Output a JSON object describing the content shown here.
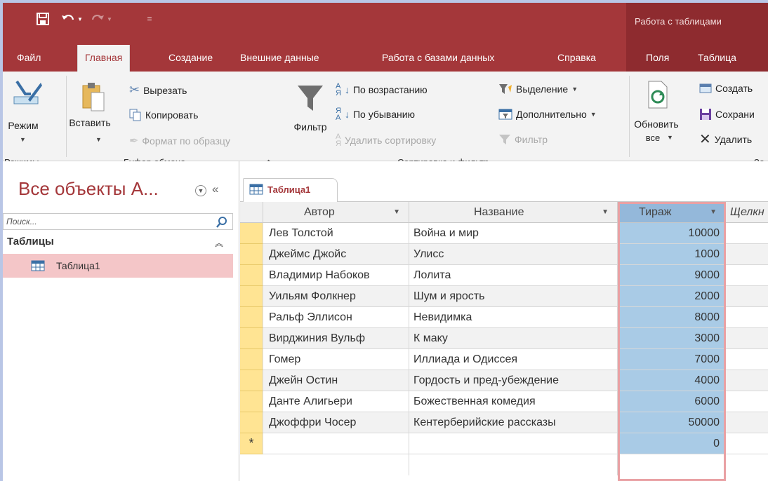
{
  "quick_access": {
    "save_icon": "save-icon",
    "undo_icon": "undo-icon",
    "redo_icon": "redo-icon",
    "customize_glyph": "="
  },
  "context_title": "Работа с таблицами",
  "tabs": [
    {
      "label": "Файл"
    },
    {
      "label": "Главная",
      "active": true
    },
    {
      "label": "Создание"
    },
    {
      "label": "Внешние данные"
    },
    {
      "label": "Работа с базами данных"
    },
    {
      "label": "Справка"
    },
    {
      "label": "Поля"
    },
    {
      "label": "Таблица"
    }
  ],
  "ribbon": {
    "views": {
      "button": "Режим",
      "group": "Режимы"
    },
    "clipboard": {
      "paste": "Вставить",
      "cut": "Вырезать",
      "copy": "Копировать",
      "format_painter": "Формат по образцу",
      "group": "Буфер обмена"
    },
    "sort_filter": {
      "filter": "Фильтр",
      "ascending": "По возрастанию",
      "descending": "По убыванию",
      "remove_sort": "Удалить сортировку",
      "selection": "Выделение",
      "advanced": "Дополнительно",
      "toggle_filter": "Фильтр",
      "group": "Сортировка и фильтр"
    },
    "records": {
      "refresh_line1": "Обновить",
      "refresh_line2": "все",
      "new": "Создать",
      "save": "Сохрани",
      "delete": "Удалить",
      "group": "За"
    }
  },
  "nav_pane": {
    "title": "Все объекты А...",
    "search_placeholder": "Поиск...",
    "group_label": "Таблицы",
    "items": [
      {
        "label": "Таблица1"
      }
    ]
  },
  "document": {
    "tab_label": "Таблица1",
    "columns": [
      "Автор",
      "Название",
      "Тираж",
      "Щелкн"
    ],
    "rows": [
      {
        "author": "Лев Толстой",
        "title": "Война и мир",
        "tirazh": "10000"
      },
      {
        "author": "Джеймс Джойс",
        "title": "Улисс",
        "tirazh": "1000"
      },
      {
        "author": "Владимир Набоков",
        "title": "Лолита",
        "tirazh": "9000"
      },
      {
        "author": "Уильям Фолкнер",
        "title": "Шум и ярость",
        "tirazh": "2000"
      },
      {
        "author": "Ральф Эллисон",
        "title": "Невидимка",
        "tirazh": "8000"
      },
      {
        "author": "Вирджиния Вульф",
        "title": " К маку",
        "tirazh": "3000"
      },
      {
        "author": "Гомер",
        "title": "Иллиада и Одиссея",
        "tirazh": "7000"
      },
      {
        "author": "Джейн Остин",
        "title": "Гордость и пред-убеждение",
        "tirazh": "4000"
      },
      {
        "author": "Данте Алигьери",
        "title": "Божественная комедия",
        "tirazh": "6000"
      },
      {
        "author": "Джоффри Чосер",
        "title": "Кентерберийские рассказы",
        "tirazh": "50000"
      }
    ],
    "new_row_marker": "*",
    "new_row_tirazh": "0"
  },
  "colors": {
    "brand": "#a4373a",
    "brand_dark": "#8e2b2f",
    "selected_column": "#a9cbe6",
    "record_selector": "#ffe493",
    "nav_selected": "#f4c6c8"
  }
}
